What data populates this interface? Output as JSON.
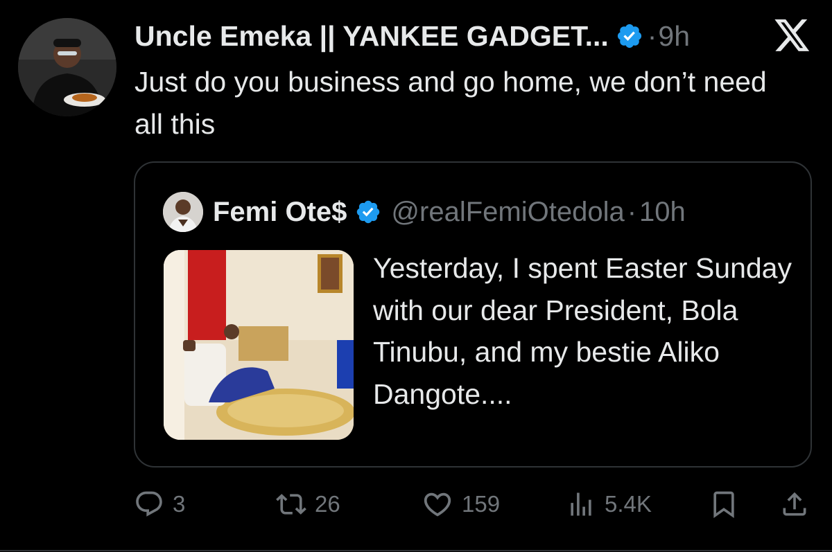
{
  "tweet": {
    "author_name": "Uncle Emeka || YANKEE GADGET...",
    "separator": "·",
    "time": "9h",
    "text": "Just do you business and go home, we don’t need all this"
  },
  "quoted_tweet": {
    "author_name": "Femi Ote$",
    "handle": "@realFemiOtedola",
    "separator": "·",
    "time": "10h",
    "text": "Yesterday, I spent Easter Sunday with our dear President, Bola Tinubu, and my bestie Aliko Dangote...."
  },
  "actions": {
    "replies": "3",
    "reposts": "26",
    "likes": "159",
    "views": "5.4K"
  },
  "colors": {
    "background": "#000000",
    "text_primary": "#e7e9ea",
    "text_secondary": "#71767b",
    "verified_blue": "#1d9bf0",
    "border": "#2f3336"
  },
  "icons": [
    "x-logo-icon",
    "verified-badge-icon",
    "reply-icon",
    "repost-icon",
    "like-icon",
    "views-icon",
    "bookmark-icon",
    "share-icon"
  ]
}
